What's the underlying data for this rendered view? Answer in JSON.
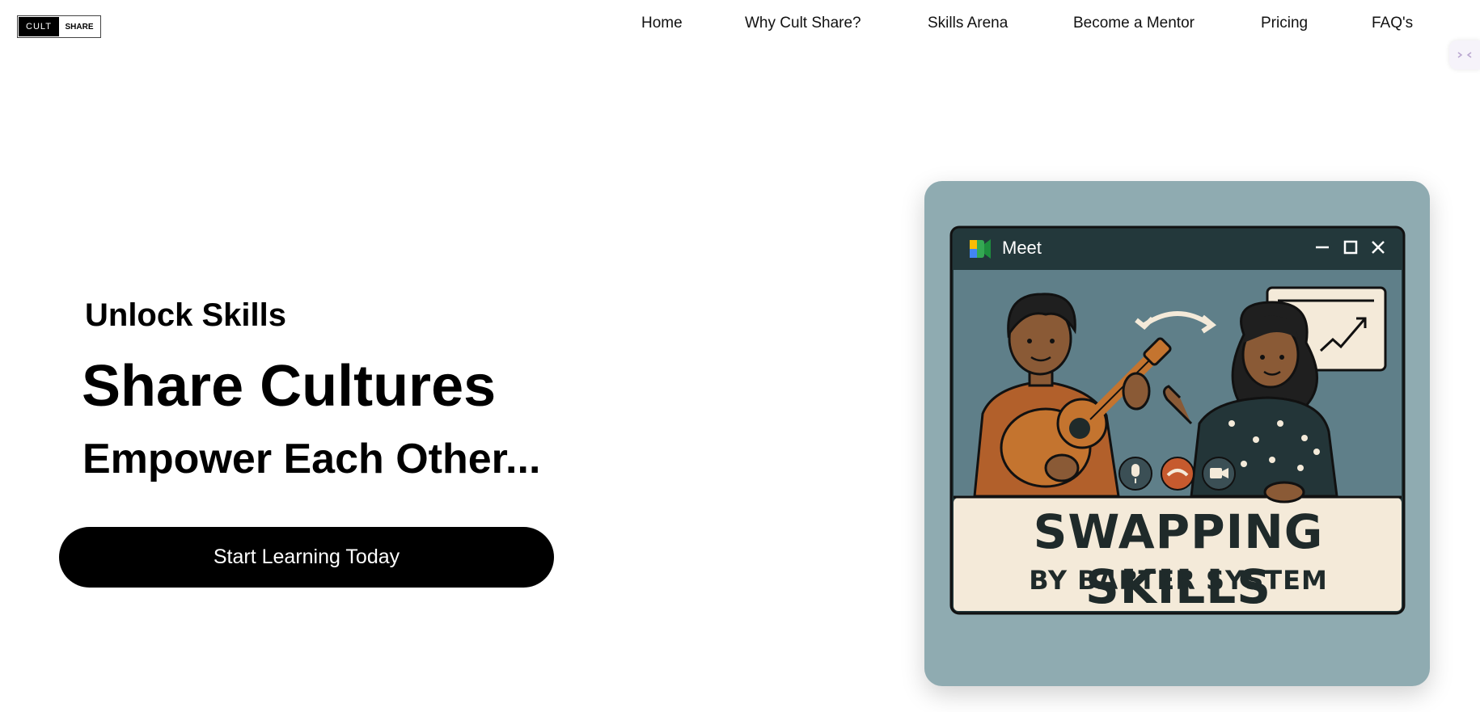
{
  "header": {
    "logo_left": "CULT",
    "logo_right": "SHARE",
    "nav": [
      "Home",
      "Why Cult Share?",
      "Skills Arena",
      "Become a Mentor",
      "Pricing",
      "FAQ's"
    ]
  },
  "hero": {
    "line1": "Unlock Skills",
    "line2": "Share Cultures",
    "line3": "Empower Each Other...",
    "cta_label": "Start Learning Today"
  },
  "illustration": {
    "window_title": "Meet",
    "banner_main": "SWAPPING SKILLS",
    "banner_sub": "BY BARTER SYSTEM",
    "icons": [
      "meet-logo-icon",
      "minimize-icon",
      "maximize-icon",
      "close-icon",
      "swap-arrows-icon",
      "chart-icon",
      "mic-icon",
      "end-call-icon",
      "camera-icon"
    ]
  },
  "colors": {
    "card_bg": "#8fabb1",
    "window_bar": "#23383b",
    "video_bg": "#5f7f89",
    "banner_bg": "#f4ead9",
    "cta_bg": "#000000"
  }
}
